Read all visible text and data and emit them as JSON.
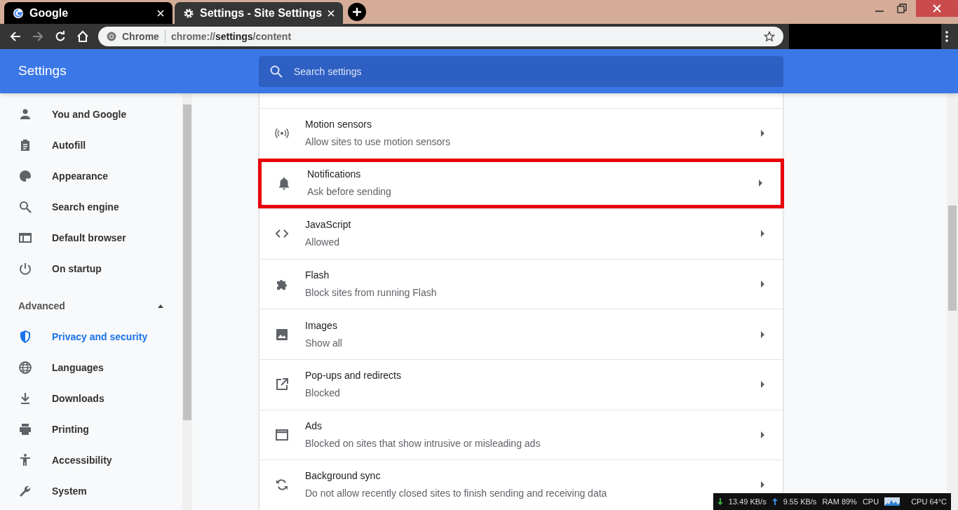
{
  "tabs": [
    {
      "title": "Google",
      "kind": "google",
      "selected": false
    },
    {
      "title": "Settings - Site Settings",
      "kind": "gear",
      "selected": true
    }
  ],
  "toolbar": {
    "origin_chip": "Chrome",
    "url": "chrome://**settings**/content"
  },
  "header": {
    "title": "Settings",
    "search": {
      "placeholder": "Search settings"
    }
  },
  "sidebar": {
    "items": [
      {
        "label": "You and Google",
        "selected": false
      },
      {
        "label": "Autofill",
        "selected": false
      },
      {
        "label": "Appearance",
        "selected": false
      },
      {
        "label": "Search engine",
        "selected": false
      },
      {
        "label": "Default browser",
        "selected": false
      },
      {
        "label": "On startup",
        "selected": false
      }
    ],
    "advanced": {
      "label": "Advanced",
      "expanded": true
    },
    "advanced_items": [
      {
        "label": "Privacy and security",
        "selected": true
      },
      {
        "label": "Languages",
        "selected": false
      },
      {
        "label": "Downloads",
        "selected": false
      },
      {
        "label": "Printing",
        "selected": false
      },
      {
        "label": "Accessibility",
        "selected": false
      },
      {
        "label": "System",
        "selected": false
      }
    ]
  },
  "site_settings": [
    {
      "title": "Motion sensors",
      "subtitle": "Allow sites to use motion sensors",
      "highlighted": false
    },
    {
      "title": "Notifications",
      "subtitle": "Ask before sending",
      "highlighted": true
    },
    {
      "title": "JavaScript",
      "subtitle": "Allowed",
      "highlighted": false
    },
    {
      "title": "Flash",
      "subtitle": "Block sites from running Flash",
      "highlighted": false
    },
    {
      "title": "Images",
      "subtitle": "Show all",
      "highlighted": false
    },
    {
      "title": "Pop-ups and redirects",
      "subtitle": "Blocked",
      "highlighted": false
    },
    {
      "title": "Ads",
      "subtitle": "Blocked on sites that show intrusive or misleading ads",
      "highlighted": false
    },
    {
      "title": "Background sync",
      "subtitle": "Do not allow recently closed sites to finish sending and receiving data",
      "highlighted": false
    }
  ],
  "system_monitor": {
    "download": "13.49 KB/s",
    "upload": "9.55 KB/s",
    "ram": "RAM 89%",
    "cpu_label": "CPU",
    "cpu_temp": "CPU 64°C"
  }
}
